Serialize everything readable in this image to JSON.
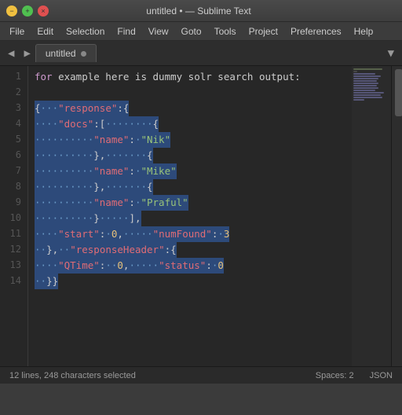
{
  "titleBar": {
    "title": "untitled • — Sublime Text",
    "minimizeLabel": "−",
    "maximizeLabel": "+",
    "closeLabel": "×"
  },
  "menuBar": {
    "items": [
      "File",
      "Edit",
      "Selection",
      "Find",
      "View",
      "Goto",
      "Tools",
      "Project",
      "Preferences",
      "Help"
    ]
  },
  "tabBar": {
    "tabName": "untitled",
    "navPrev": "◀",
    "navNext": "▶",
    "arrowDown": "▼"
  },
  "editor": {
    "lines": [
      {
        "num": "1",
        "content": "for example here is dummy solr search output:"
      },
      {
        "num": "2",
        "content": ""
      },
      {
        "num": "3",
        "content": "{···\"response\":{"
      },
      {
        "num": "4",
        "content": "····\"docs\":[········{"
      },
      {
        "num": "5",
        "content": "··········\"name\":·\"Nik\""
      },
      {
        "num": "6",
        "content": "··········},·······{"
      },
      {
        "num": "7",
        "content": "··········\"name\":·\"Mike\""
      },
      {
        "num": "8",
        "content": "··········},·······{"
      },
      {
        "num": "9",
        "content": "··········\"name\":·\"Praful\""
      },
      {
        "num": "10",
        "content": "··········}·····],"
      },
      {
        "num": "11",
        "content": "····\"start\":·0,·····\"numFound\":·3"
      },
      {
        "num": "12",
        "content": "··},··\"responseHeader\":{"
      },
      {
        "num": "13",
        "content": "····\"QTime\":··0,·····\"status\":·0"
      },
      {
        "num": "14",
        "content": "··}}"
      }
    ]
  },
  "statusBar": {
    "selectionInfo": "12 lines, 248 characters selected",
    "spaces": "Spaces: 2",
    "syntax": "JSON"
  }
}
